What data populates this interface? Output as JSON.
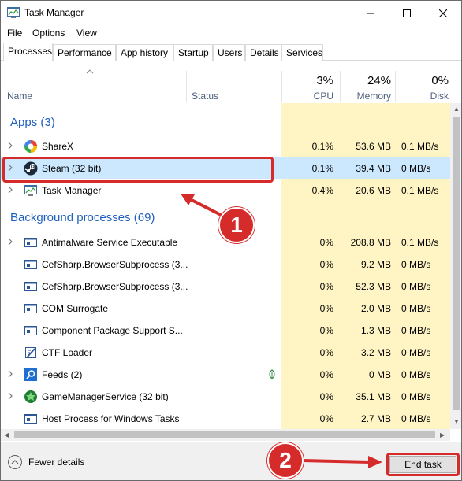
{
  "window": {
    "title": "Task Manager"
  },
  "menu": [
    "File",
    "Options",
    "View"
  ],
  "tabs": [
    "Processes",
    "Performance",
    "App history",
    "Startup",
    "Users",
    "Details",
    "Services"
  ],
  "columns": {
    "name": "Name",
    "status": "Status",
    "cpu": {
      "pct": "3%",
      "label": "CPU"
    },
    "memory": {
      "pct": "24%",
      "label": "Memory"
    },
    "disk": {
      "pct": "0%",
      "label": "Disk"
    }
  },
  "groups": {
    "apps": "Apps (3)",
    "background": "Background processes (69)"
  },
  "apps": [
    {
      "name": "ShareX",
      "cpu": "0.1%",
      "memory": "53.6 MB",
      "disk": "0.1 MB/s",
      "icon": "sharex-icon"
    },
    {
      "name": "Steam (32 bit)",
      "cpu": "0.1%",
      "memory": "39.4 MB",
      "disk": "0 MB/s",
      "icon": "steam-icon"
    },
    {
      "name": "Task Manager",
      "cpu": "0.4%",
      "memory": "20.6 MB",
      "disk": "0.1 MB/s",
      "icon": "task-manager-icon"
    }
  ],
  "background": [
    {
      "name": "Antimalware Service Executable",
      "cpu": "0%",
      "memory": "208.8 MB",
      "disk": "0.1 MB/s",
      "icon": "service-window-icon"
    },
    {
      "name": "CefSharp.BrowserSubprocess (3...",
      "cpu": "0%",
      "memory": "9.2 MB",
      "disk": "0 MB/s",
      "icon": "service-window-icon"
    },
    {
      "name": "CefSharp.BrowserSubprocess (3...",
      "cpu": "0%",
      "memory": "52.3 MB",
      "disk": "0 MB/s",
      "icon": "service-window-icon"
    },
    {
      "name": "COM Surrogate",
      "cpu": "0%",
      "memory": "2.0 MB",
      "disk": "0 MB/s",
      "icon": "service-window-icon"
    },
    {
      "name": "Component Package Support S...",
      "cpu": "0%",
      "memory": "1.3 MB",
      "disk": "0 MB/s",
      "icon": "service-window-icon"
    },
    {
      "name": "CTF Loader",
      "cpu": "0%",
      "memory": "3.2 MB",
      "disk": "0 MB/s",
      "icon": "ctf-loader-icon"
    },
    {
      "name": "Feeds (2)",
      "cpu": "0%",
      "memory": "0 MB",
      "disk": "0 MB/s",
      "icon": "search-feeds-icon"
    },
    {
      "name": "GameManagerService (32 bit)",
      "cpu": "0%",
      "memory": "35.1 MB",
      "disk": "0 MB/s",
      "icon": "game-manager-icon"
    },
    {
      "name": "Host Process for Windows Tasks",
      "cpu": "0%",
      "memory": "2.7 MB",
      "disk": "0 MB/s",
      "icon": "service-window-icon"
    }
  ],
  "footer": {
    "fewer_details": "Fewer details",
    "end_task": "End task"
  },
  "annotations": {
    "step1": "1",
    "step2": "2",
    "color": "#d62b2b"
  },
  "colors": {
    "heat": "#fff4c4",
    "selected": "#cce8ff",
    "group_title": "#1e5fbf"
  }
}
